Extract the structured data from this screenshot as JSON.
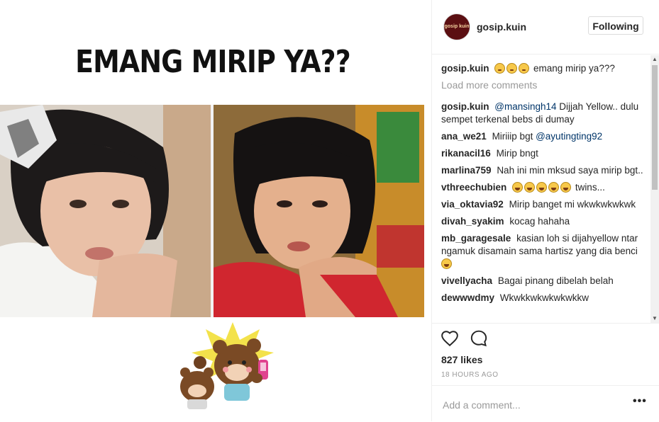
{
  "post": {
    "headline": "EMANG MIRIP YA??"
  },
  "header": {
    "username": "gosip.kuin",
    "avatar_text": "gosip kuin",
    "follow_label": "Following"
  },
  "caption": {
    "user": "gosip.kuin",
    "emoji_count": 3,
    "text": "emang mirip ya???"
  },
  "load_more": "Load more comments",
  "comments": [
    {
      "user": "gosip.kuin",
      "mention": "@mansingh14",
      "text": "Dijjah Yellow.. dulu sempet terkenal bebs di dumay"
    },
    {
      "user": "ana_we21",
      "text": "Miriiip bgt",
      "mention_after": "@ayutingting92"
    },
    {
      "user": "rikanacil16",
      "text": "Mirip bngt"
    },
    {
      "user": "marlina759",
      "text": "Nah ini min mksud saya mirip bgt.."
    },
    {
      "user": "vthreechubien",
      "emoji_count": 5,
      "text": "twins..."
    },
    {
      "user": "via_oktavia92",
      "text": "Mirip banget mi wkwkwkwkwk"
    },
    {
      "user": "divah_syakim",
      "text": "kocag hahaha"
    },
    {
      "user": "mb_garagesale",
      "text": "kasian loh si dijahyellow ntar ngamuk disamain sama hartisz yang dia benci",
      "emoji_count": 1
    },
    {
      "user": "vivellyacha",
      "text": "Bagai pinang dibelah belah"
    },
    {
      "user": "dewwwdmy",
      "text": "Wkwkkwkwkwkwkkw"
    }
  ],
  "likes": "827 likes",
  "timestamp": "18 HOURS AGO",
  "add_comment_placeholder": "Add a comment...",
  "more_options": "•••",
  "colors": {
    "link": "#003569",
    "muted": "#999999",
    "border": "#efefef",
    "text": "#262626"
  }
}
